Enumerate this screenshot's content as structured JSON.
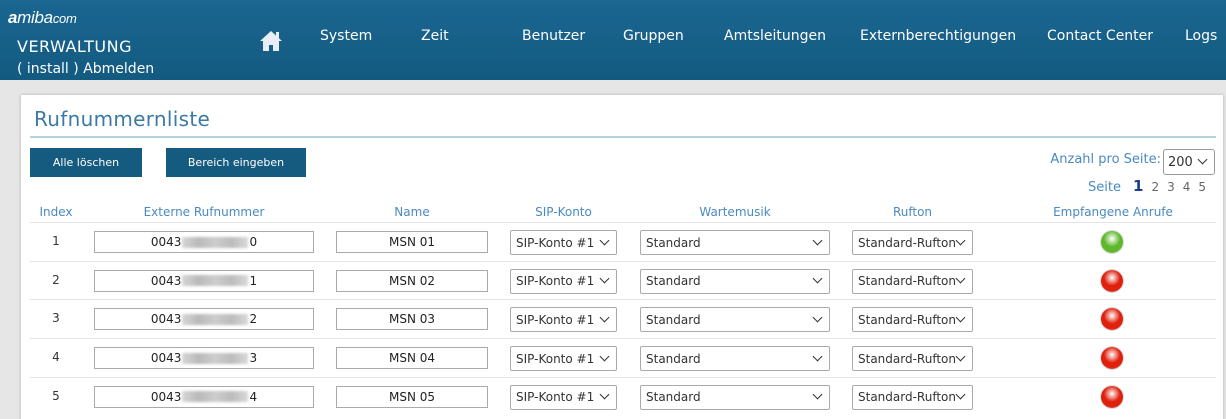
{
  "brand": {
    "logo_a": "a",
    "logo_rest": "miba",
    "logo_com": "com",
    "title": "VERWALTUNG",
    "user_open": "( ",
    "user_name": "install",
    "user_close": " ) ",
    "logout": "Abmelden"
  },
  "nav": {
    "items": [
      "System",
      "Zeit",
      "Benutzer",
      "Gruppen",
      "Amtsleitungen",
      "Externberechtigungen",
      "Contact Center",
      "Logs"
    ]
  },
  "page": {
    "title": "Rufnummernliste"
  },
  "toolbar": {
    "delete_all": "Alle löschen",
    "enter_range": "Bereich eingeben",
    "per_page_label": "Anzahl pro Seite:",
    "per_page_value": "200"
  },
  "pager": {
    "label": "Seite",
    "pages": [
      "1",
      "2",
      "3",
      "4",
      "5"
    ],
    "current": "1"
  },
  "table": {
    "headers": [
      "Index",
      "Externe Rufnummer",
      "Name",
      "SIP-Konto",
      "Wartemusik",
      "Rufton",
      "Empfangene Anrufe"
    ],
    "rows": [
      {
        "index": "1",
        "number_prefix": "0043",
        "number_suffix": "0",
        "name": "MSN 01",
        "sip": "SIP-Konto #1",
        "music": "Standard",
        "ring": "Standard-Rufton",
        "status": "green"
      },
      {
        "index": "2",
        "number_prefix": "0043",
        "number_suffix": "1",
        "name": "MSN 02",
        "sip": "SIP-Konto #1",
        "music": "Standard",
        "ring": "Standard-Rufton",
        "status": "red"
      },
      {
        "index": "3",
        "number_prefix": "0043",
        "number_suffix": "2",
        "name": "MSN 03",
        "sip": "SIP-Konto #1",
        "music": "Standard",
        "ring": "Standard-Rufton",
        "status": "red"
      },
      {
        "index": "4",
        "number_prefix": "0043",
        "number_suffix": "3",
        "name": "MSN 04",
        "sip": "SIP-Konto #1",
        "music": "Standard",
        "ring": "Standard-Rufton",
        "status": "red"
      },
      {
        "index": "5",
        "number_prefix": "0043",
        "number_suffix": "4",
        "name": "MSN 05",
        "sip": "SIP-Konto #1",
        "music": "Standard",
        "ring": "Standard-Rufton",
        "status": "red"
      }
    ]
  },
  "colors": {
    "header_bg": "#135a80",
    "button_bg": "#155a7f",
    "accent_text": "#4a8ac0",
    "led_green": "#5fb82a",
    "led_red": "#e01f0c"
  },
  "icons": {
    "home": "home-icon",
    "dropdown": "chevron-down-icon",
    "status_led": "status-led-icon"
  }
}
